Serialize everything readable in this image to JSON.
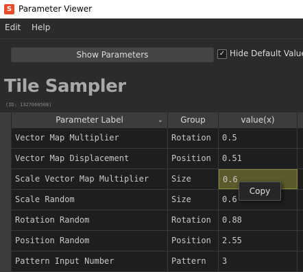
{
  "window": {
    "title": "Parameter Viewer",
    "app_icon": "S"
  },
  "menu": {
    "items": [
      "Edit",
      "Help"
    ]
  },
  "toolbar": {
    "show_parameters_label": "Show Parameters",
    "hide_default_values_label": "Hide Default Values",
    "hide_default_values_checked": true
  },
  "node": {
    "title": "Tile Sampler",
    "id": "(ID: 1327060508)"
  },
  "table": {
    "headers": {
      "label": "Parameter Label",
      "group": "Group",
      "value": "value(x)"
    },
    "rows": [
      {
        "label": "Vector Map Multiplier",
        "group": "Rotation",
        "value": "0.5"
      },
      {
        "label": "Vector Map Displacement",
        "group": "Position",
        "value": "0.51"
      },
      {
        "label": "Scale Vector Map Multiplier",
        "group": "Size",
        "value": "0.6"
      },
      {
        "label": "Scale Random",
        "group": "Size",
        "value": "0.6"
      },
      {
        "label": "Rotation Random",
        "group": "Rotation",
        "value": "0.88"
      },
      {
        "label": "Position Random",
        "group": "Position",
        "value": "2.55"
      },
      {
        "label": "Pattern Input Number",
        "group": "Pattern",
        "value": "3"
      }
    ]
  },
  "context_menu": {
    "items": [
      "Copy"
    ]
  }
}
